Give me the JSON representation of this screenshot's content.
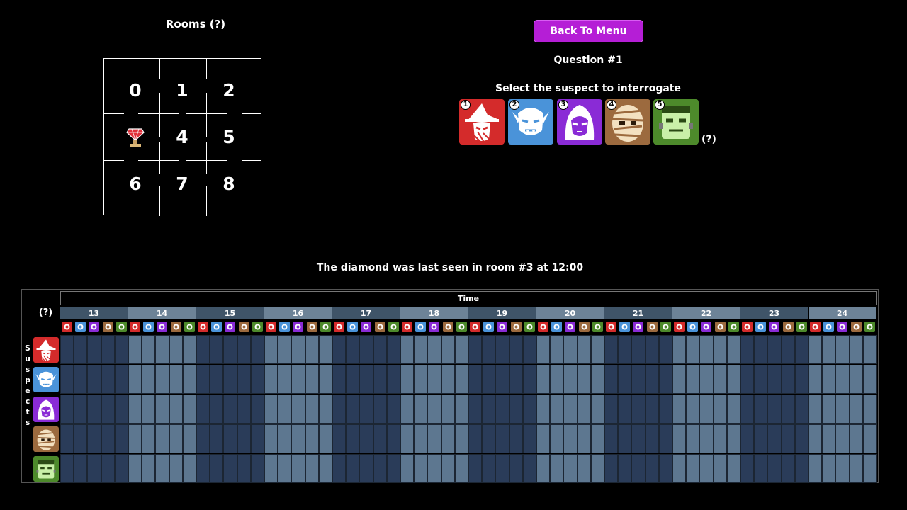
{
  "rooms": {
    "title": "Rooms (?)",
    "cells": [
      "0",
      "1",
      "2",
      "",
      "4",
      "5",
      "6",
      "7",
      "8"
    ],
    "diamond_room_index": 3
  },
  "menu": {
    "back_button_underlined": "B",
    "back_button_rest": "ack To Menu"
  },
  "question": {
    "label": "Question #1"
  },
  "interrogate": {
    "prompt": "Select the suspect to interrogate",
    "help": "(?)"
  },
  "suspects": [
    {
      "number": "1",
      "name": "witch",
      "color": "#d42b2b"
    },
    {
      "number": "2",
      "name": "ghoul",
      "color": "#4a93d9"
    },
    {
      "number": "3",
      "name": "vampire",
      "color": "#8a2bd6"
    },
    {
      "number": "4",
      "name": "mummy",
      "color": "#9c6a3e"
    },
    {
      "number": "5",
      "name": "frankenstein",
      "color": "#4d8a2b"
    }
  ],
  "diamond_message": "The diamond was last seen in room #3 at 12:00",
  "timeline": {
    "help": "(?)",
    "time_label": "Time",
    "suspects_label": [
      "S",
      "u",
      "s",
      "p",
      "e",
      "c",
      "t",
      "s"
    ],
    "hours": [
      "13",
      "14",
      "15",
      "16",
      "17",
      "18",
      "19",
      "20",
      "21",
      "22",
      "23",
      "24"
    ],
    "colors": {
      "dark": "#2a3c59",
      "light": "#5d7790",
      "header_dark": "#3f5468",
      "header_light": "#6d8397"
    }
  }
}
